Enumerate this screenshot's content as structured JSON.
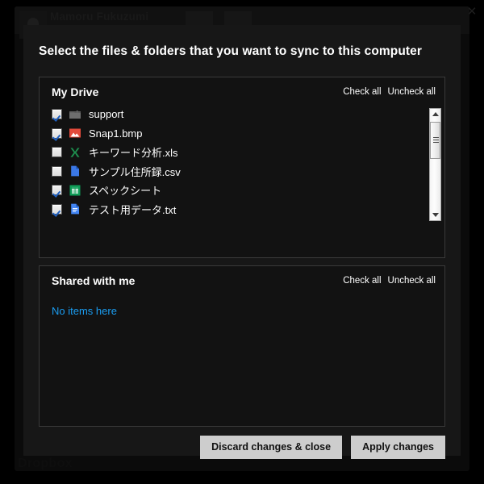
{
  "background_window": {
    "title": "Mamoru Fukuzumi",
    "avatar_icon": "person-avatar-icon",
    "footer_text": "Dropbox",
    "close_icon": "close-icon",
    "close_label": "✕"
  },
  "dialog": {
    "title": "Select the files & folders that you want to sync to this computer",
    "panels": [
      {
        "id": "my-drive",
        "title": "My Drive",
        "check_all_label": "Check all",
        "uncheck_all_label": "Uncheck all",
        "scrollbar": {
          "up_arrow_icon": "triangle-up-icon",
          "down_arrow_icon": "triangle-down-icon",
          "thumb_icon": "scrollbar-thumb"
        },
        "items": [
          {
            "name": "support",
            "checked": true,
            "icon": "folder-icon",
            "icon_color": "#6e6e6e"
          },
          {
            "name": "Snap1.bmp",
            "checked": true,
            "icon": "image-file-icon",
            "icon_color": "#e24a3b"
          },
          {
            "name": "キーワード分析.xls",
            "checked": false,
            "icon": "excel-file-icon",
            "icon_color": "#1e8e4e"
          },
          {
            "name": "サンプル住所録.csv",
            "checked": false,
            "icon": "blue-page-icon",
            "icon_color": "#3b78e7"
          },
          {
            "name": "スペックシート",
            "checked": true,
            "icon": "google-sheets-icon",
            "icon_color": "#0f9d58"
          },
          {
            "name": "テスト用データ.txt",
            "checked": true,
            "icon": "google-docs-icon",
            "icon_color": "#4285f4"
          }
        ]
      },
      {
        "id": "shared-with-me",
        "title": "Shared with me",
        "check_all_label": "Check all",
        "uncheck_all_label": "Uncheck all",
        "empty_message": "No items here",
        "items": []
      }
    ],
    "buttons": [
      {
        "id": "discard",
        "label": "Discard changes & close"
      },
      {
        "id": "apply",
        "label": "Apply changes"
      }
    ]
  },
  "colors": {
    "dialog_bg": "#171717",
    "panel_bg": "#121212",
    "panel_border": "#3a3a3a",
    "text": "#ffffff",
    "link": "#1a9cf0",
    "button_bg": "#cdcdcd",
    "checkmark": "#1f5fbf"
  }
}
